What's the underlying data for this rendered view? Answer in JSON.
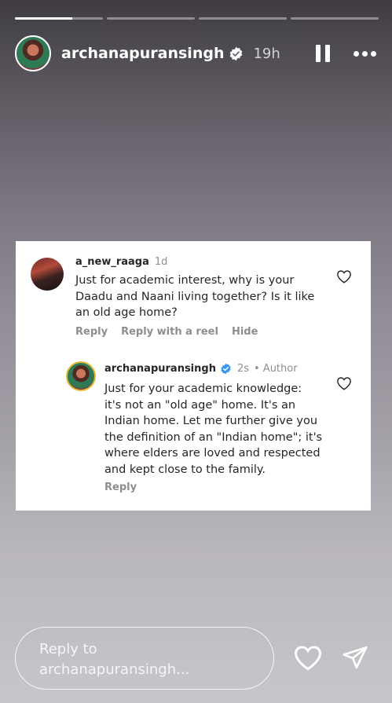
{
  "story": {
    "progress": [
      1,
      0,
      0,
      0
    ],
    "progress_active_fraction": 0.65
  },
  "header": {
    "username": "archanapuransingh",
    "time": "19h"
  },
  "comment": {
    "username": "a_new_raaga",
    "age": "1d",
    "lines": [
      "Just for academic interest, why is your",
      "Daadu and Naani living together? Is it like",
      "an old age home?"
    ],
    "actions": [
      "Reply",
      "Reply with a reel",
      "Hide"
    ]
  },
  "reply": {
    "username": "archanapuransingh",
    "age": "2s",
    "role": "• Author",
    "lines": [
      "Just for your academic knowledge:",
      "it's not an \"old age\" home. It's an",
      "Indian home. Let me further give you",
      "the definition of an \"Indian home\"; it's",
      "where elders are loved and respected",
      "and kept close to the family."
    ],
    "action": "Reply"
  },
  "footer": {
    "placeholder_line1": "Reply to",
    "placeholder_line2": "archanapuransingh..."
  },
  "colors": {
    "verified": "#3897f0",
    "text": "#262626",
    "muted": "#8e8e8e"
  }
}
